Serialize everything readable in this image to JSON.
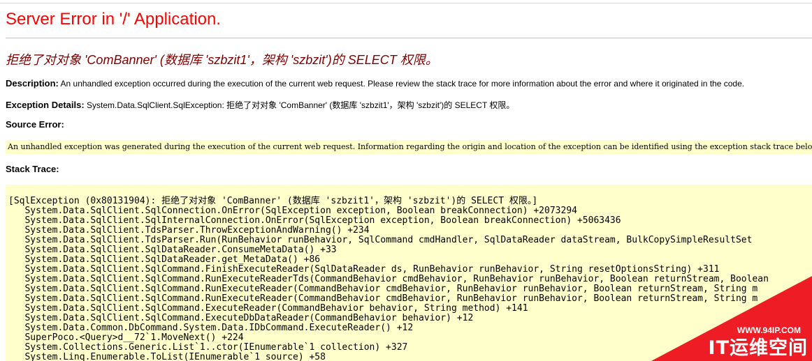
{
  "page": {
    "title": "Server Error in '/' Application.",
    "error_message": "拒绝了对对象 'ComBanner' (数据库 'szbzit1'，架构 'szbzit')的 SELECT 权限。"
  },
  "description": {
    "label": "Description:",
    "text": "An unhandled exception occurred during the execution of the current web request. Please review the stack trace for more information about the error and where it originated in the code."
  },
  "exception_details": {
    "label": "Exception Details:",
    "text": "System.Data.SqlClient.SqlException: 拒绝了对对象 'ComBanner' (数据库 'szbzit1'，架构 'szbzit')的 SELECT 权限。"
  },
  "source_error": {
    "label": "Source Error:",
    "text": "An unhandled exception was generated during the execution of the current web request. Information regarding the origin and location of the exception can be identified using the exception stack trace below."
  },
  "stack_trace": {
    "label": "Stack Trace:",
    "lines": [
      "[SqlException (0x80131904): 拒绝了对对象 'ComBanner' (数据库 'szbzit1'，架构 'szbzit')的 SELECT 权限。]",
      "   System.Data.SqlClient.SqlConnection.OnError(SqlException exception, Boolean breakConnection) +2073294",
      "   System.Data.SqlClient.SqlInternalConnection.OnError(SqlException exception, Boolean breakConnection) +5063436",
      "   System.Data.SqlClient.TdsParser.ThrowExceptionAndWarning() +234",
      "   System.Data.SqlClient.TdsParser.Run(RunBehavior runBehavior, SqlCommand cmdHandler, SqlDataReader dataStream, BulkCopySimpleResultSet",
      "   System.Data.SqlClient.SqlDataReader.ConsumeMetaData() +33",
      "   System.Data.SqlClient.SqlDataReader.get_MetaData() +86",
      "   System.Data.SqlClient.SqlCommand.FinishExecuteReader(SqlDataReader ds, RunBehavior runBehavior, String resetOptionsString) +311",
      "   System.Data.SqlClient.SqlCommand.RunExecuteReaderTds(CommandBehavior cmdBehavior, RunBehavior runBehavior, Boolean returnStream, Boolean",
      "   System.Data.SqlClient.SqlCommand.RunExecuteReader(CommandBehavior cmdBehavior, RunBehavior runBehavior, Boolean returnStream, String m",
      "   System.Data.SqlClient.SqlCommand.RunExecuteReader(CommandBehavior cmdBehavior, RunBehavior runBehavior, Boolean returnStream, String m",
      "   System.Data.SqlClient.SqlCommand.ExecuteReader(CommandBehavior behavior, String method) +141",
      "   System.Data.SqlClient.SqlCommand.ExecuteDbDataReader(CommandBehavior behavior) +12",
      "   System.Data.Common.DbCommand.System.Data.IDbCommand.ExecuteReader() +12",
      "   SuperPoco.<Query>d__72`1.MoveNext() +224",
      "   System.Collections.Generic.List`1..ctor(IEnumerable`1 collection) +327",
      "   System.Linq.Enumerable.ToList(IEnumerable`1 source) +58"
    ]
  },
  "watermark": {
    "url": "WWW.94IP.COM",
    "logo": "IT运维空间",
    "color": "#ee1c25"
  }
}
